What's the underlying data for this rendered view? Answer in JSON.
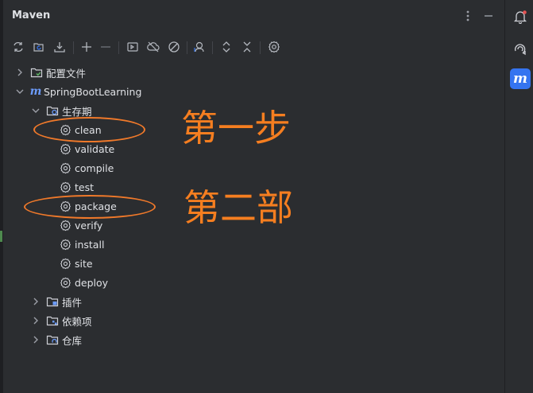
{
  "panel": {
    "title": "Maven"
  },
  "tree": {
    "config": "配置文件",
    "project": "SpringBootLearning",
    "lifecycle": "生存期",
    "phases": [
      "clean",
      "validate",
      "compile",
      "test",
      "package",
      "verify",
      "install",
      "site",
      "deploy"
    ],
    "plugins": "插件",
    "dependencies": "依赖项",
    "repositories": "仓库"
  },
  "annotations": {
    "step1": "第一步",
    "step2": "第二部"
  },
  "colors": {
    "annotation": "#f57e20",
    "accent": "#3574f0",
    "background": "#2b2d30"
  }
}
